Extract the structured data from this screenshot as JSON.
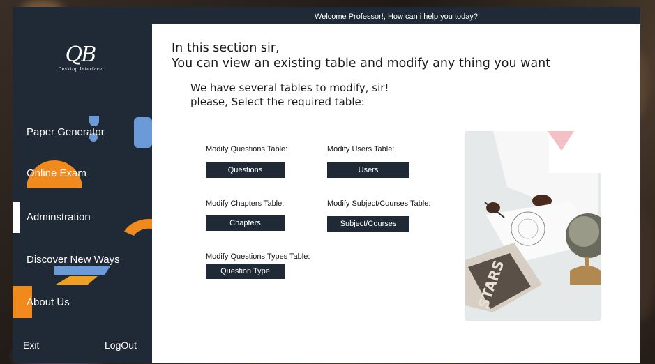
{
  "window": {
    "greeting": "Welcome Professor!, How can i help you today?"
  },
  "sidebar": {
    "logo_mark": "QB",
    "logo_subtitle": "Desktop Interface",
    "items": [
      {
        "label": "Paper Generator"
      },
      {
        "label": "Online Exam"
      },
      {
        "label": "Adminstration",
        "active": true
      },
      {
        "label": "Discover New Ways"
      },
      {
        "label": "About Us"
      }
    ],
    "exit_label": "Exit",
    "logout_label": "LogOut"
  },
  "main": {
    "heading_line1": "In this section sir,",
    "heading_line2": "You can view an existing table and modify any thing you want",
    "sub_line1": "We have several tables to modify, sir!",
    "sub_line2": "please, Select the required table:",
    "tables": {
      "questions": {
        "label": "Modify Questions Table:",
        "button": "Questions"
      },
      "users": {
        "label": "Modify Users Table:",
        "button": "Users"
      },
      "chapters": {
        "label": "Modify Chapters Table:",
        "button": "Chapters"
      },
      "subjects": {
        "label": "Modify Subject/Courses Table:",
        "button": "Subject/Courses"
      },
      "question_types": {
        "label": "Modify Questions Types Table:",
        "button": "Question Type"
      }
    }
  },
  "colors": {
    "sidebar": "#1f2a36",
    "accent_orange": "#f08a1c",
    "accent_blue": "#6a9bd8",
    "button": "#1f2a36"
  }
}
